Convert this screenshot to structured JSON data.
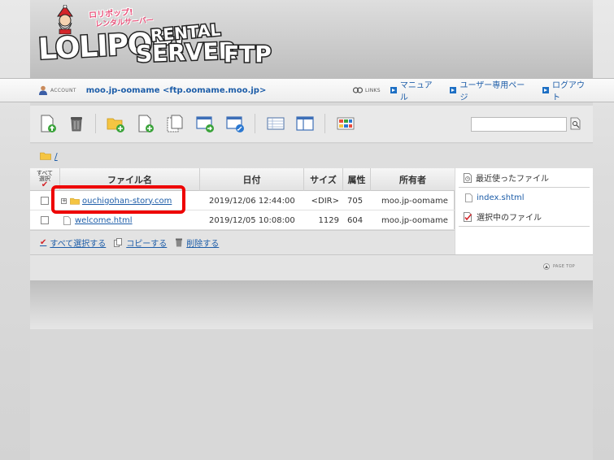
{
  "logo": {
    "top_tag": "ロリポップ!",
    "sub_tag": "レンタルサーバー",
    "main": "LOLIPOP!",
    "rental": "RENTAL",
    "server": "SERVER",
    "ftp": "FTP"
  },
  "account_bar": {
    "account_label": "ACCOUNT",
    "account_value": "moo.jp-oomame <ftp.oomame.moo.jp>",
    "links_label": "LINKS",
    "links": [
      "マニュアル",
      "ユーザー専用ページ",
      "ログアウト"
    ]
  },
  "toolbar": {
    "search_placeholder": ""
  },
  "path": "/",
  "table": {
    "select_all_label_line1": "すべて",
    "select_all_label_line2": "選択",
    "select_all_check": "✔",
    "headers": [
      "ファイル名",
      "日付",
      "サイズ",
      "属性",
      "所有者"
    ],
    "rows": [
      {
        "name": "ouchigohan-story.com",
        "date": "2019/12/06 12:44:00",
        "size": "<DIR>",
        "attr": "705",
        "owner": "moo.jp-oomame"
      },
      {
        "name": "welcome.html",
        "date": "2019/12/05 10:08:00",
        "size": "1129",
        "attr": "604",
        "owner": "moo.jp-oomame"
      }
    ]
  },
  "actions": {
    "select_all": "すべて選択する",
    "copy": "コピーする",
    "delete": "削除する"
  },
  "side": {
    "recent_title": "最近使ったファイル",
    "recent_file": "index.shtml",
    "selected_title": "選択中のファイル"
  },
  "footer": {
    "page_top": "PAGE TOP"
  },
  "colors": {
    "link": "#1d5da8",
    "highlight": "#e00000",
    "accent_red": "#d4252a"
  }
}
